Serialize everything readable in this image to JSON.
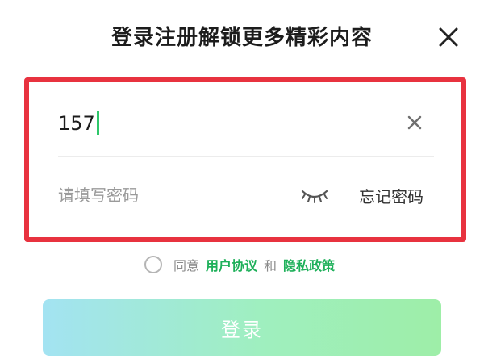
{
  "header": {
    "title": "登录注册解锁更多精彩内容",
    "close_icon": "close-icon"
  },
  "form": {
    "phone_value": "157",
    "clear_icon": "clear-icon",
    "password_placeholder": "请填写密码",
    "eye_icon": "eye-closed-icon",
    "forgot_password": "忘记密码"
  },
  "agreement": {
    "prefix": "同意",
    "user_agreement": "用户协议",
    "conjunction": "和",
    "privacy_policy": "隐私政策"
  },
  "login_button": {
    "label": "登录"
  },
  "colors": {
    "highlight_border": "#e8323f",
    "link_green": "#1eb05a",
    "caret_green": "#2ec76a"
  }
}
